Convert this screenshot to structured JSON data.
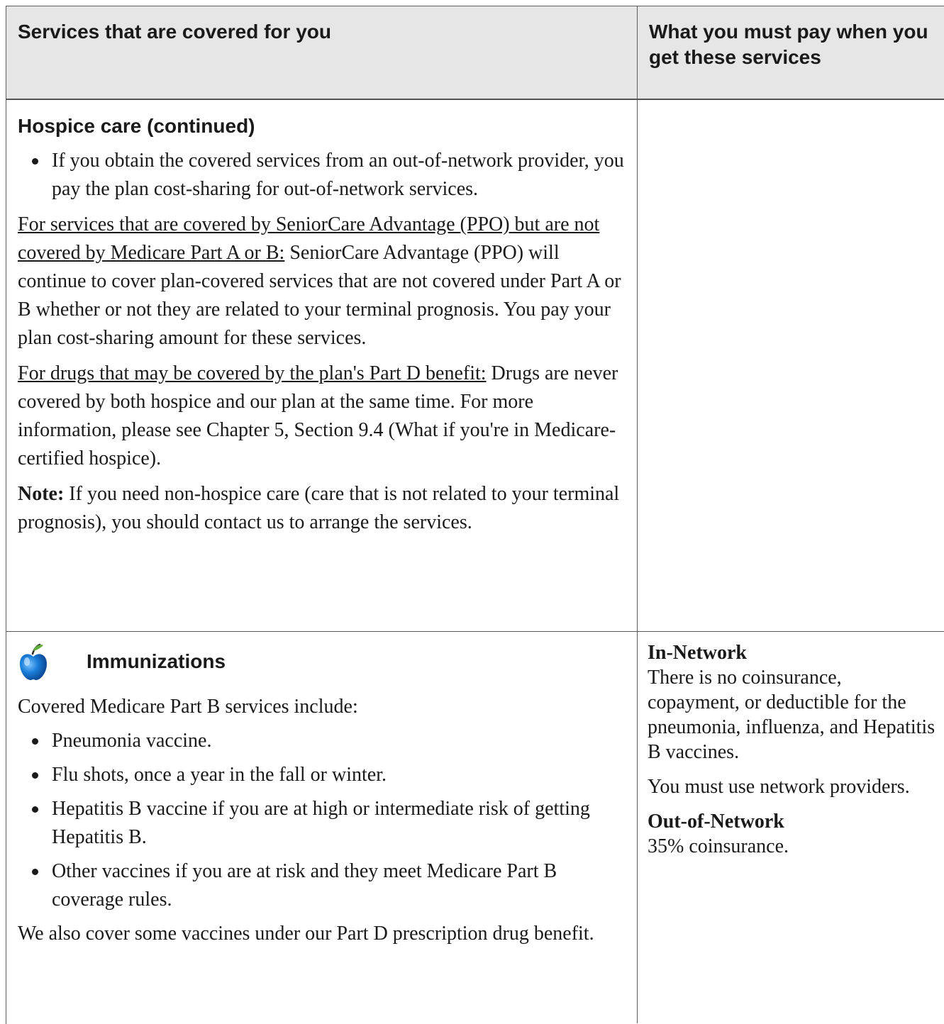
{
  "header": {
    "col1": "Services that are covered for you",
    "col2": "What you must pay when you get these services"
  },
  "hospice": {
    "title": "Hospice care (continued)",
    "bullets": [
      "If you obtain the covered services from an out-of-network provider, you pay the plan cost-sharing for out-of-network services."
    ],
    "para1_underlined": "For services that are covered by SeniorCare Advantage (PPO) but are not covered by Medicare Part A or B:",
    "para1_rest": " SeniorCare Advantage (PPO) will continue to cover plan-covered services that are not covered under Part A or B whether or not they are related to your terminal prognosis. You pay your plan cost-sharing amount for these services.",
    "para2_underlined": "For drugs that may be covered by the plan's Part D benefit:",
    "para2_rest": " Drugs are never covered by both hospice and our plan at the same time. For more information, please see Chapter 5, Section 9.4 (What if you're in Medicare-certified hospice).",
    "note_label": "Note:",
    "note_rest": " If you need non-hospice care (care that is not related to your terminal prognosis), you should contact us to arrange the services."
  },
  "immunizations": {
    "icon": "apple-icon",
    "title": "Immunizations",
    "intro": "Covered Medicare Part B services include:",
    "bullets": [
      "Pneumonia vaccine.",
      "Flu shots, once a year in the fall or winter.",
      "Hepatitis B vaccine if you are at high or intermediate risk of getting Hepatitis B.",
      "Other vaccines if you are at risk and they meet Medicare Part B coverage rules."
    ],
    "closing": "We also cover some vaccines under our Part D prescription drug benefit.",
    "in_network_label": "In-Network",
    "in_network_text": "There is no coinsurance, copayment, or deductible for the pneumonia, influenza, and Hepatitis B vaccines.",
    "in_network_note": "You must use network providers.",
    "out_network_label": "Out-of-Network",
    "out_network_text": "35% coinsurance."
  },
  "colors": {
    "header_bg": "#e6e6e6",
    "border": "#5c5c5c",
    "text": "#1a1a1a"
  }
}
